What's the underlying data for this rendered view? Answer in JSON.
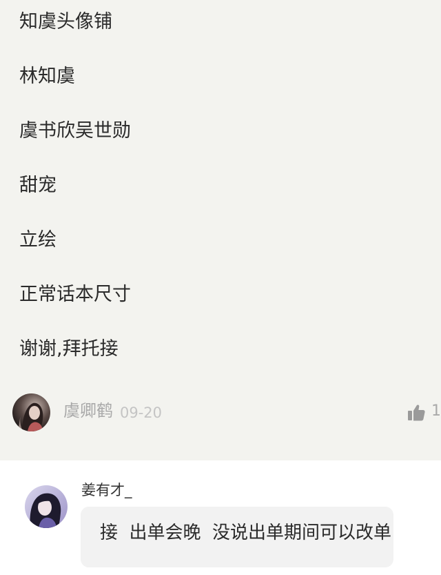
{
  "post": {
    "lines": [
      "知虞头像铺",
      "林知虞",
      "虞书欣吴世勋",
      "甜宠",
      "立绘",
      "正常话本尺寸",
      "谢谢,拜托接"
    ]
  },
  "author": {
    "name": "虞卿鹤",
    "date": "09-20",
    "like_icon": "thumbs-up-icon",
    "like_count": "1"
  },
  "reply": {
    "name": "姜有才_",
    "text": "接  出单会晚  没说出单期间可以改单"
  },
  "colors": {
    "post_background": "#f3f3ef",
    "reply_background": "#ffffff",
    "bubble_background": "#f2f2f2",
    "muted_text": "#a9a9a9"
  }
}
